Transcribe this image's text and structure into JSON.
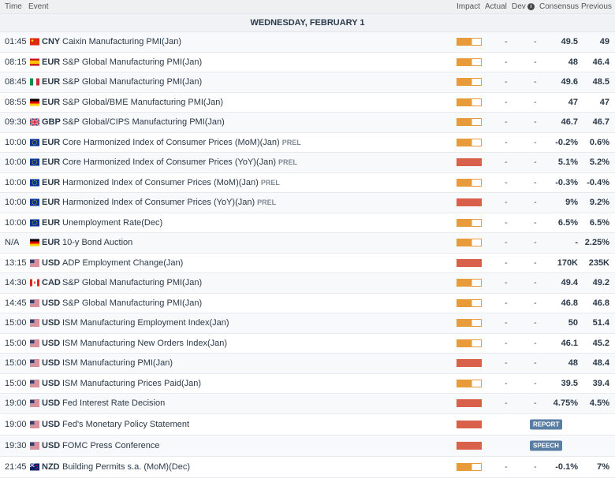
{
  "header": {
    "time": "Time",
    "event": "Event",
    "impact": "Impact",
    "actual": "Actual",
    "dev": "Dev",
    "info_icon": "i",
    "consensus": "Consensus",
    "previous": "Previous"
  },
  "day": "WEDNESDAY, FEBRUARY 1",
  "rows": [
    {
      "time": "01:45",
      "flag": "cn",
      "cur": "CNY",
      "event": "Caixin Manufacturing PMI(Jan)",
      "prel": "",
      "impact": "medium",
      "actual": "-",
      "dev": "-",
      "cons": "49.5",
      "prev": "49"
    },
    {
      "time": "08:15",
      "flag": "es",
      "cur": "EUR",
      "event": "S&P Global Manufacturing PMI(Jan)",
      "prel": "",
      "impact": "medium",
      "actual": "-",
      "dev": "-",
      "cons": "48",
      "prev": "46.4"
    },
    {
      "time": "08:45",
      "flag": "it",
      "cur": "EUR",
      "event": "S&P Global Manufacturing PMI(Jan)",
      "prel": "",
      "impact": "medium",
      "actual": "-",
      "dev": "-",
      "cons": "49.6",
      "prev": "48.5"
    },
    {
      "time": "08:55",
      "flag": "de",
      "cur": "EUR",
      "event": "S&P Global/BME Manufacturing PMI(Jan)",
      "prel": "",
      "impact": "medium",
      "actual": "-",
      "dev": "-",
      "cons": "47",
      "prev": "47"
    },
    {
      "time": "09:30",
      "flag": "gb",
      "cur": "GBP",
      "event": "S&P Global/CIPS Manufacturing PMI(Jan)",
      "prel": "",
      "impact": "medium",
      "actual": "-",
      "dev": "-",
      "cons": "46.7",
      "prev": "46.7"
    },
    {
      "time": "10:00",
      "flag": "eu",
      "cur": "EUR",
      "event": "Core Harmonized Index of Consumer Prices (MoM)(Jan)",
      "prel": "PREL",
      "impact": "medium",
      "actual": "-",
      "dev": "-",
      "cons": "-0.2%",
      "prev": "0.6%"
    },
    {
      "time": "10:00",
      "flag": "eu",
      "cur": "EUR",
      "event": "Core Harmonized Index of Consumer Prices (YoY)(Jan)",
      "prel": "PREL",
      "impact": "high",
      "actual": "-",
      "dev": "-",
      "cons": "5.1%",
      "prev": "5.2%"
    },
    {
      "time": "10:00",
      "flag": "eu",
      "cur": "EUR",
      "event": "Harmonized Index of Consumer Prices (MoM)(Jan)",
      "prel": "PREL",
      "impact": "medium",
      "actual": "-",
      "dev": "-",
      "cons": "-0.3%",
      "prev": "-0.4%"
    },
    {
      "time": "10:00",
      "flag": "eu",
      "cur": "EUR",
      "event": "Harmonized Index of Consumer Prices (YoY)(Jan)",
      "prel": "PREL",
      "impact": "high",
      "actual": "-",
      "dev": "-",
      "cons": "9%",
      "prev": "9.2%"
    },
    {
      "time": "10:00",
      "flag": "eu",
      "cur": "EUR",
      "event": "Unemployment Rate(Dec)",
      "prel": "",
      "impact": "medium",
      "actual": "-",
      "dev": "-",
      "cons": "6.5%",
      "prev": "6.5%"
    },
    {
      "time": "N/A",
      "flag": "de",
      "cur": "EUR",
      "event": "10-y Bond Auction",
      "prel": "",
      "impact": "medium",
      "actual": "-",
      "dev": "-",
      "cons": "-",
      "prev": "2.25%"
    },
    {
      "time": "13:15",
      "flag": "us",
      "cur": "USD",
      "event": "ADP Employment Change(Jan)",
      "prel": "",
      "impact": "high",
      "actual": "-",
      "dev": "-",
      "cons": "170K",
      "prev": "235K"
    },
    {
      "time": "14:30",
      "flag": "ca",
      "cur": "CAD",
      "event": "S&P Global Manufacturing PMI(Jan)",
      "prel": "",
      "impact": "medium",
      "actual": "-",
      "dev": "-",
      "cons": "49.4",
      "prev": "49.2"
    },
    {
      "time": "14:45",
      "flag": "us",
      "cur": "USD",
      "event": "S&P Global Manufacturing PMI(Jan)",
      "prel": "",
      "impact": "medium",
      "actual": "-",
      "dev": "-",
      "cons": "46.8",
      "prev": "46.8"
    },
    {
      "time": "15:00",
      "flag": "us",
      "cur": "USD",
      "event": "ISM Manufacturing Employment Index(Jan)",
      "prel": "",
      "impact": "medium",
      "actual": "-",
      "dev": "-",
      "cons": "50",
      "prev": "51.4"
    },
    {
      "time": "15:00",
      "flag": "us",
      "cur": "USD",
      "event": "ISM Manufacturing New Orders Index(Jan)",
      "prel": "",
      "impact": "medium",
      "actual": "-",
      "dev": "-",
      "cons": "46.1",
      "prev": "45.2"
    },
    {
      "time": "15:00",
      "flag": "us",
      "cur": "USD",
      "event": "ISM Manufacturing PMI(Jan)",
      "prel": "",
      "impact": "high",
      "actual": "-",
      "dev": "-",
      "cons": "48",
      "prev": "48.4"
    },
    {
      "time": "15:00",
      "flag": "us",
      "cur": "USD",
      "event": "ISM Manufacturing Prices Paid(Jan)",
      "prel": "",
      "impact": "medium",
      "actual": "-",
      "dev": "-",
      "cons": "39.5",
      "prev": "39.4"
    },
    {
      "time": "19:00",
      "flag": "us",
      "cur": "USD",
      "event": "Fed Interest Rate Decision",
      "prel": "",
      "impact": "high",
      "actual": "-",
      "dev": "-",
      "cons": "4.75%",
      "prev": "4.5%"
    },
    {
      "time": "19:00",
      "flag": "us",
      "cur": "USD",
      "event": "Fed's Monetary Policy Statement",
      "prel": "",
      "impact": "high",
      "actual": "",
      "dev": "",
      "cons": "",
      "prev": "",
      "badge": "REPORT"
    },
    {
      "time": "19:30",
      "flag": "us",
      "cur": "USD",
      "event": "FOMC Press Conference",
      "prel": "",
      "impact": "high",
      "actual": "",
      "dev": "",
      "cons": "",
      "prev": "",
      "badge": "SPEECH"
    },
    {
      "time": "21:45",
      "flag": "nz",
      "cur": "NZD",
      "event": "Building Permits s.a. (MoM)(Dec)",
      "prel": "",
      "impact": "medium",
      "actual": "-",
      "dev": "-",
      "cons": "-0.1%",
      "prev": "7%"
    }
  ]
}
